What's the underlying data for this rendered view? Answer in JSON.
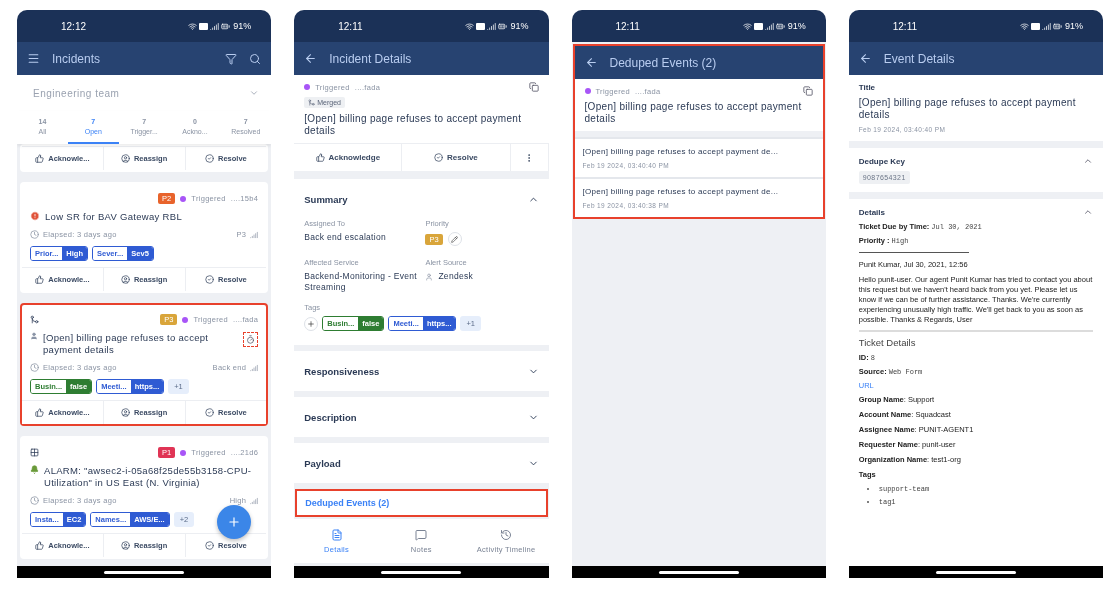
{
  "incidents_screen": {
    "status_bar": {
      "time": "12:12",
      "battery": "91%"
    },
    "title": "Incidents",
    "team": "Engineering team",
    "tabs": [
      {
        "count": "14",
        "label": "All",
        "selected": false
      },
      {
        "count": "7",
        "label": "Open",
        "selected": true
      },
      {
        "count": "7",
        "label": "Trigger...",
        "selected": false
      },
      {
        "count": "0",
        "label": "Ackno...",
        "selected": false
      },
      {
        "count": "7",
        "label": "Resolved",
        "selected": false
      }
    ],
    "cards": [
      {
        "partial": true,
        "highlighted": false,
        "actions": [
          "Acknowle...",
          "Reassign",
          "Resolve"
        ]
      },
      {
        "partial": false,
        "highlighted": false,
        "annotated_icon": false,
        "priority": {
          "label": "P2",
          "color": "#e8632b"
        },
        "status": {
          "text": "Triggered",
          "color": "#a855f7"
        },
        "short_id": "....15b4",
        "source_icon": {
          "kind": "alert",
          "color": "#e0533a"
        },
        "title": "Low SR for BAV Gateway RBL",
        "elapsed": "Elapsed: 3 days ago",
        "meta": "P3",
        "tags": [
          {
            "key": "Prior...",
            "value": "High",
            "color": "#2f5bd3"
          },
          {
            "key": "Sever...",
            "value": "Sev5",
            "color": "#2f5bd3"
          }
        ],
        "actions": [
          "Acknowle...",
          "Reassign",
          "Resolve"
        ]
      },
      {
        "partial": false,
        "highlighted": true,
        "annotated_icon": true,
        "marker": {
          "kind": "merge"
        },
        "priority": {
          "label": "P3",
          "color": "#d9a53a"
        },
        "status": {
          "text": "Triggered",
          "color": "#a855f7"
        },
        "short_id": "....fada",
        "source_icon": {
          "kind": "user",
          "color": "#8a94a6"
        },
        "title": "[Open] billing page refuses to accept payment details",
        "elapsed": "Elapsed: 3 days ago",
        "meta": "Back end",
        "tags": [
          {
            "key": "Busin...",
            "value": "false",
            "color": "#2e7d32"
          },
          {
            "key": "Meeti...",
            "value": "https...",
            "color": "#2f5bd3"
          }
        ],
        "more": "+1",
        "actions": [
          "Acknowle...",
          "Reassign",
          "Resolve"
        ]
      },
      {
        "partial": false,
        "highlighted": false,
        "annotated_icon": false,
        "marker": {
          "kind": "group"
        },
        "priority": {
          "label": "P1",
          "color": "#e03455"
        },
        "status": {
          "text": "Triggered",
          "color": "#a855f7"
        },
        "short_id": "....21d6",
        "source_icon": {
          "kind": "bell",
          "color": "#6a9a3a"
        },
        "title": "ALARM: \"awsec2-i-05a68f25de55b3158-CPU-Utilization\" in US East (N. Virginia)",
        "elapsed": "Elapsed: 3 days ago",
        "meta": "High",
        "tags": [
          {
            "key": "Insta...",
            "value": "EC2",
            "color": "#2f5bd3"
          },
          {
            "key": "Names...",
            "value": "AWS/E...",
            "color": "#2f5bd3"
          }
        ],
        "more": "+2",
        "actions": [
          "Acknowle...",
          "Reassign",
          "Resolve"
        ]
      }
    ]
  },
  "incident_details_screen": {
    "status_bar": {
      "time": "12:11",
      "battery": "91%"
    },
    "title": "Incident Details",
    "status": {
      "text": "Triggered",
      "color": "#a855f7"
    },
    "short_id": "....fada",
    "merged_label": "Merged",
    "incident_title": "[Open] billing page refuses to accept payment details",
    "actions": [
      "Acknowledge",
      "Resolve"
    ],
    "summary": {
      "title": "Summary",
      "expanded": true,
      "fields": [
        {
          "kind": "text",
          "label": "Assigned To",
          "value": "Back end escalation"
        },
        {
          "kind": "priority",
          "label": "Priority",
          "value": "P3",
          "color": "#d9a53a"
        },
        {
          "kind": "text",
          "label": "Affected Service",
          "value": "Backend-Monitoring - Event Streaming"
        },
        {
          "kind": "source",
          "label": "Alert Source",
          "value": "Zendesk"
        }
      ],
      "tags_label": "Tags",
      "tags": [
        {
          "key": "Busin...",
          "value": "false",
          "color": "#2e7d32"
        },
        {
          "key": "Meeti...",
          "value": "https...",
          "color": "#2f5bd3"
        }
      ],
      "more": "+1"
    },
    "sections": [
      {
        "title": "Responsiveness",
        "expanded": false
      },
      {
        "title": "Description",
        "expanded": false
      },
      {
        "title": "Payload",
        "expanded": false
      }
    ],
    "deduped_link": {
      "text": "Deduped Events (2)",
      "highlighted": true
    },
    "bottom_nav": [
      {
        "label": "Details",
        "selected": true
      },
      {
        "label": "Notes",
        "selected": false
      },
      {
        "label": "Activity Timeline",
        "selected": false
      }
    ]
  },
  "deduped_events_screen": {
    "status_bar": {
      "time": "12:11",
      "battery": "91%"
    },
    "title": "Deduped Events (2)",
    "highlighted": true,
    "status": {
      "text": "Triggered",
      "color": "#a855f7"
    },
    "short_id": "....fada",
    "incident_title": "[Open] billing page refuses to accept payment details",
    "events": [
      {
        "title": "[Open] billing page refuses to accept payment de...",
        "time": "Feb 19 2024, 03:40:40 PM"
      },
      {
        "title": "[Open] billing page refuses to accept payment de...",
        "time": "Feb 19 2024, 03:40:38 PM"
      }
    ]
  },
  "event_details_screen": {
    "status_bar": {
      "time": "12:11",
      "battery": "91%"
    },
    "title": "Event Details",
    "title_section": {
      "label": "Title",
      "text": "[Open] billing page refuses to accept payment details",
      "time": "Feb 19 2024, 03:40:40 PM"
    },
    "dedupe_key": {
      "label": "Dedupe Key",
      "expanded": true,
      "value": "9087654321"
    },
    "details": {
      "label": "Details",
      "expanded": true,
      "lines": [
        {
          "kind": "field",
          "label": "Ticket Due by Time:",
          "value": "Jul 30, 2021"
        },
        {
          "kind": "field",
          "label": "Priority :",
          "value": "High"
        },
        {
          "kind": "rule"
        },
        {
          "kind": "text",
          "text": "Punit Kumar, Jul 30, 2021, 12:56"
        },
        {
          "kind": "text",
          "text": "Hello punit-user. Our agent Punit Kumar has tried to contact you about this request but we haven't heard back from you yet. Please let us know if we can be of further assistance. Thanks. We're currently experiencing unusually high traffic. We'll get back to you as soon as possible. Thanks & Regards, User"
        },
        {
          "kind": "divider"
        },
        {
          "kind": "heading",
          "text": "Ticket Details"
        },
        {
          "kind": "field",
          "label": "ID:",
          "value": "8"
        },
        {
          "kind": "field",
          "label": "Source:",
          "value": "Web Form"
        },
        {
          "kind": "link",
          "text": "URL"
        },
        {
          "kind": "text",
          "text": "**Group Name**: Support"
        },
        {
          "kind": "text",
          "text": "**Account Name**: Squadcast"
        },
        {
          "kind": "text",
          "text": "**Assignee Name**: PUNIT-AGENT1"
        },
        {
          "kind": "text",
          "text": "**Requester Name**: punit-user"
        },
        {
          "kind": "text",
          "text": "**Organization Name**: test1-org"
        },
        {
          "kind": "label",
          "text": "Tags"
        },
        {
          "kind": "bullet",
          "text": "support-team"
        },
        {
          "kind": "bullet",
          "text": "tag1"
        }
      ]
    }
  }
}
